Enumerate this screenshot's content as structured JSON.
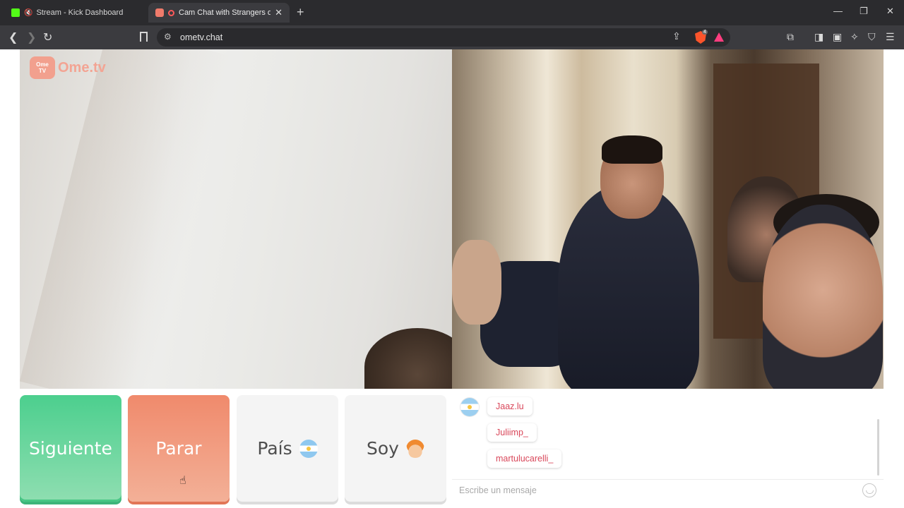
{
  "browser": {
    "tabs": [
      {
        "title": "Stream - Kick Dashboard",
        "active": false
      },
      {
        "title": "Cam Chat with Strangers on O",
        "active": true
      }
    ],
    "url": "ometv.chat",
    "shields_count": "4"
  },
  "site": {
    "logo_badge_top": "Ome",
    "logo_badge_bottom": "TV",
    "logo_text": "Ome.tv"
  },
  "controls": {
    "next_label": "Siguiente",
    "stop_label": "Parar",
    "country_label": "País",
    "gender_label": "Soy"
  },
  "chat": {
    "messages": [
      "Jaaz.lu",
      "Juliimp_",
      "martulucarelli_"
    ],
    "input_placeholder": "Escribe un mensaje"
  },
  "colors": {
    "next": "#4ccf8e",
    "stop": "#f08a6c",
    "chat_text": "#d9475a",
    "logo": "#f3a493"
  }
}
